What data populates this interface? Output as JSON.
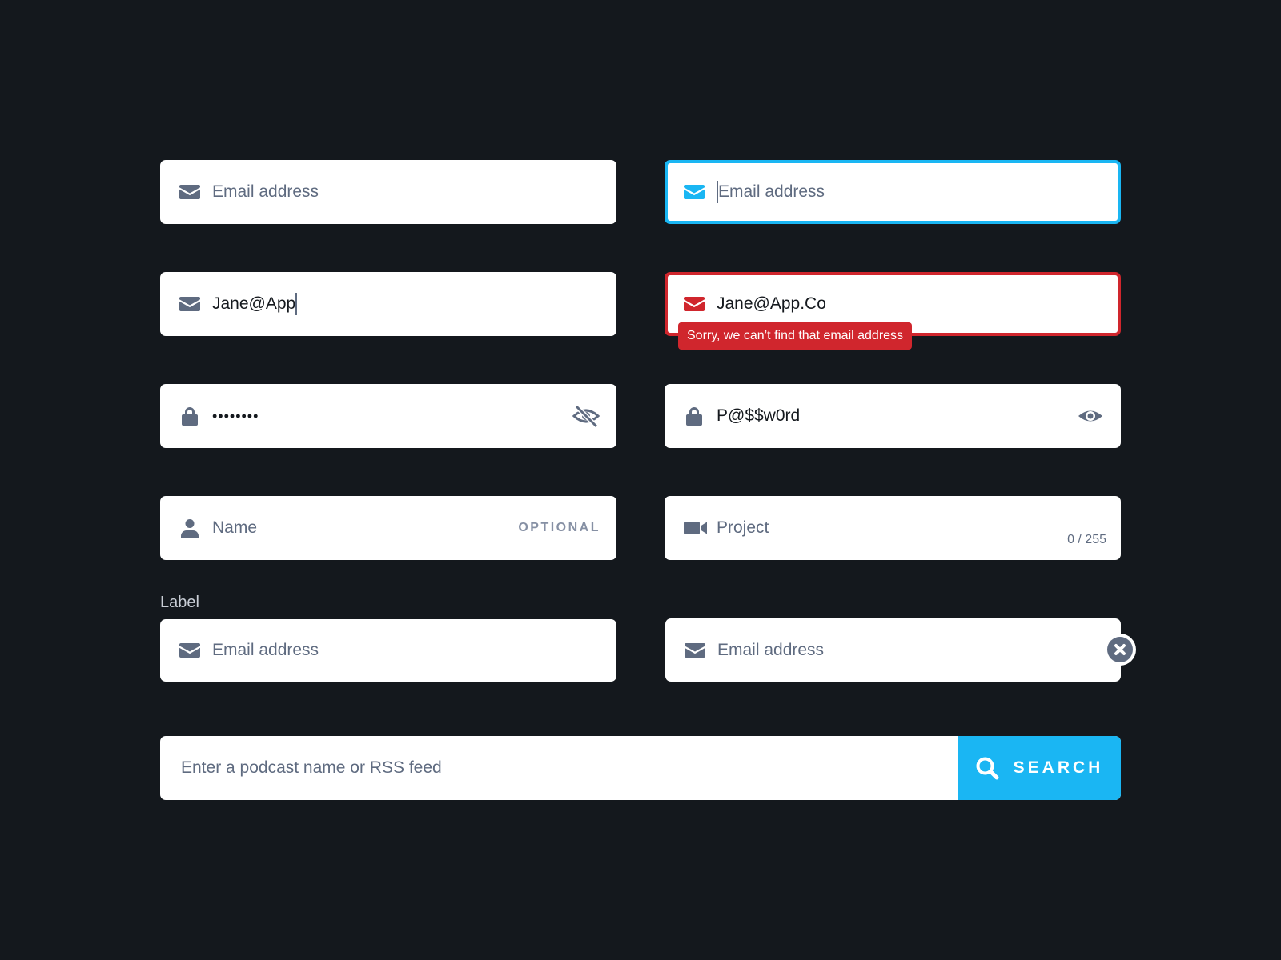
{
  "colors": {
    "background": "#14181d",
    "accent": "#1ab6f3",
    "error": "#d0262d",
    "icon": "#5f6b80",
    "label": "#c9ced6"
  },
  "fields": {
    "email_default": {
      "placeholder": "Email address",
      "icon": "envelope-icon"
    },
    "email_focused": {
      "placeholder": "Email address",
      "icon": "envelope-icon"
    },
    "email_typing": {
      "value": "Jane@App",
      "icon": "envelope-icon"
    },
    "email_error": {
      "value": "Jane@App.Co",
      "error": "Sorry, we can’t find that email address",
      "icon": "envelope-icon"
    },
    "password_hidden": {
      "value": "••••••••",
      "icon": "lock-icon",
      "toggle_icon": "eye-slash-icon"
    },
    "password_visible": {
      "value": "P@$$w0rd",
      "icon": "lock-icon",
      "toggle_icon": "eye-icon"
    },
    "name": {
      "placeholder": "Name",
      "badge": "OPTIONAL",
      "icon": "user-icon"
    },
    "project": {
      "placeholder": "Project",
      "counter": "0 / 255",
      "icon": "video-camera-icon"
    },
    "labeled_email": {
      "label": "Label",
      "placeholder": "Email address",
      "icon": "envelope-icon"
    },
    "clearable_email": {
      "placeholder": "Email address",
      "icon": "envelope-icon",
      "clear_icon": "close-icon"
    }
  },
  "search": {
    "placeholder": "Enter a podcast name or RSS feed",
    "button_label": "SEARCH",
    "icon": "search-icon"
  }
}
